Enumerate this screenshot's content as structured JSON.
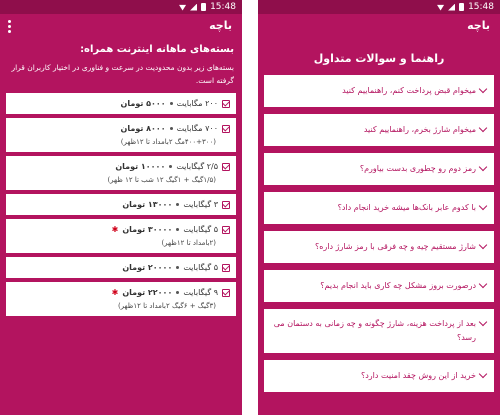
{
  "status": {
    "time": "15:48"
  },
  "left": {
    "app_title": "باچه",
    "intro_title": "بسته‌های ماهانه اینترنت همراه:",
    "intro_body": "بسته‌های زیر بدون محدودیت در سرعت و فناوری در اختیار کاربران قرار گرفته است.",
    "packages": [
      {
        "volume": "۲۰۰ مگابایت",
        "price": "۵۰۰۰ تومان",
        "note": "",
        "special": false
      },
      {
        "volume": "۷۰۰ مگابایت",
        "price": "۸۰۰۰ تومان",
        "note": "(۴۰۰+۳۰۰مگ ۲بامداد تا ۱۲ظهر)",
        "special": false
      },
      {
        "volume": "۲/۵ گیگابایت",
        "price": "۱۰۰۰۰ تومان",
        "note": "(۱/۵گیگ + ۱گیگ ۱۲ شب تا ۱۲ ظهر)",
        "special": false
      },
      {
        "volume": "۳ گیگابایت",
        "price": "۱۳۰۰۰ تومان",
        "note": "",
        "special": false
      },
      {
        "volume": "۵ گیگابایت",
        "price": "۳۰۰۰۰ تومان",
        "note": "(۲بامداد تا ۱۲ظهر)",
        "special": true
      },
      {
        "volume": "۵ گیگابایت",
        "price": "۲۰۰۰۰ تومان",
        "note": "",
        "special": false
      },
      {
        "volume": "۹ گیگابایت",
        "price": "۲۲۰۰۰ تومان",
        "note": "(۳گیگ + ۶گیگ ۲بامداد تا ۱۲ظهر)",
        "special": true
      }
    ]
  },
  "right": {
    "app_title": "باچه",
    "faq_title": "راهنما و سوالات متداول",
    "questions": [
      "میخوام قبض پرداخت کنم، راهنماییم کنید",
      "میخوام شارژ بخرم، راهنماییم کنید",
      "رمز دوم رو چطوری بدست بیاورم؟",
      "با کدوم عابر بانک‌ها میشه خرید انجام داد؟",
      "شارژ مستقیم چیه و چه فرقی با رمز شارژ داره؟",
      "درصورت بروز مشکل چه کاری باید انجام بدیم؟",
      "بعد از پرداخت هزینه، شارژ چگونه و چه زمانی به دستمان می رسد؟",
      "خرید از این روش چقد امنیت دارد؟"
    ]
  }
}
